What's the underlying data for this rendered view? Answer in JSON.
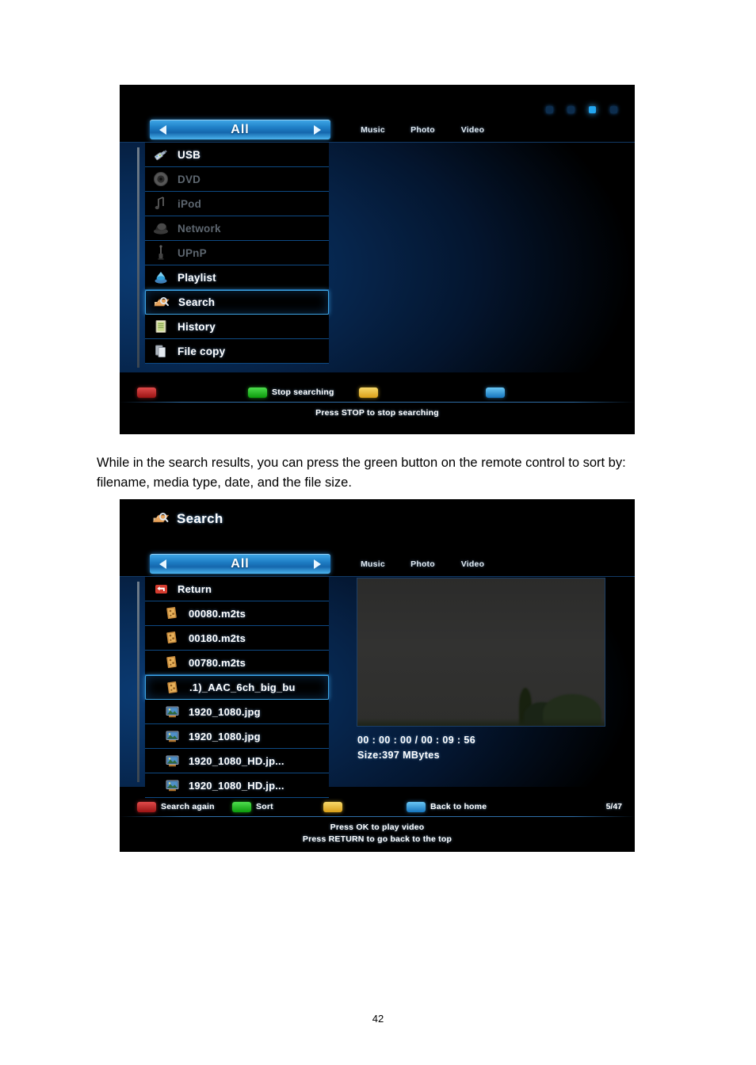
{
  "document": {
    "paragraph": "While in the search results, you can press the green button on the remote control to sort by: filename, media type, date, and the file size.",
    "page_number": "42"
  },
  "screenshot_1": {
    "name": "home-media-menu-searching",
    "filter": {
      "selected": "All",
      "prev_icon": "triangle-left-icon",
      "next_icon": "triangle-right-icon",
      "tabs": [
        "Music",
        "Photo",
        "Video"
      ]
    },
    "indicators": [
      {
        "name": "indicator-1",
        "active": false
      },
      {
        "name": "indicator-2",
        "active": false
      },
      {
        "name": "indicator-3",
        "active": true
      },
      {
        "name": "indicator-4",
        "active": false
      }
    ],
    "menu": [
      {
        "label": "USB",
        "icon": "usb-icon",
        "state": "normal"
      },
      {
        "label": "DVD",
        "icon": "disc-icon",
        "state": "disabled"
      },
      {
        "label": "iPod",
        "icon": "note-icon",
        "state": "disabled"
      },
      {
        "label": "Network",
        "icon": "network-icon",
        "state": "disabled"
      },
      {
        "label": "UPnP",
        "icon": "upnp-icon",
        "state": "disabled"
      },
      {
        "label": "Playlist",
        "icon": "playlist-icon",
        "state": "normal"
      },
      {
        "label": "Search",
        "icon": "search-icon",
        "state": "selected"
      },
      {
        "label": "History",
        "icon": "history-icon",
        "state": "normal"
      },
      {
        "label": "File copy",
        "icon": "copy-icon",
        "state": "normal"
      }
    ],
    "keys": [
      {
        "color": "red",
        "label": ""
      },
      {
        "color": "green",
        "label": "Stop searching"
      },
      {
        "color": "yellow",
        "label": ""
      },
      {
        "color": "blue",
        "label": ""
      }
    ],
    "hints": [
      "Press STOP to stop searching"
    ]
  },
  "screenshot_2": {
    "name": "search-results-list",
    "title": "Search",
    "title_icon": "search-icon",
    "filter": {
      "selected": "All",
      "prev_icon": "triangle-left-icon",
      "next_icon": "triangle-right-icon",
      "tabs": [
        "Music",
        "Photo",
        "Video"
      ]
    },
    "files": [
      {
        "label": "Return",
        "icon": "return-icon",
        "state": "normal"
      },
      {
        "label": "00080.m2ts",
        "icon": "video-file-icon",
        "state": "normal"
      },
      {
        "label": "00180.m2ts",
        "icon": "video-file-icon",
        "state": "normal"
      },
      {
        "label": "00780.m2ts",
        "icon": "video-file-icon",
        "state": "normal"
      },
      {
        "label": ".1)_AAC_6ch_big_bu",
        "icon": "video-file-icon",
        "state": "selected"
      },
      {
        "label": "1920_1080.jpg",
        "icon": "image-file-icon",
        "state": "normal"
      },
      {
        "label": "1920_1080.jpg",
        "icon": "image-file-icon",
        "state": "normal"
      },
      {
        "label": "1920_1080_HD.jp...",
        "icon": "image-file-icon",
        "state": "normal"
      },
      {
        "label": "1920_1080_HD.jp...",
        "icon": "image-file-icon",
        "state": "normal"
      }
    ],
    "preview": {
      "time": "00 : 00 : 00  / 00 : 09 : 56",
      "size": "Size:397 MBytes"
    },
    "keys": [
      {
        "color": "red",
        "label": "Search again"
      },
      {
        "color": "green",
        "label": "Sort"
      },
      {
        "color": "yellow",
        "label": ""
      },
      {
        "color": "blue",
        "label": "Back to home"
      }
    ],
    "counter": "5/47",
    "hints": [
      "Press OK to play video",
      "Press RETURN to go back to the top"
    ]
  },
  "colors": {
    "accent_blue": "#23a6f0",
    "select_border": "#3ea5e4",
    "key_red": "#e04a4a",
    "key_green": "#4ede4e",
    "key_yellow": "#f7d96a",
    "key_blue": "#69c6f4"
  }
}
